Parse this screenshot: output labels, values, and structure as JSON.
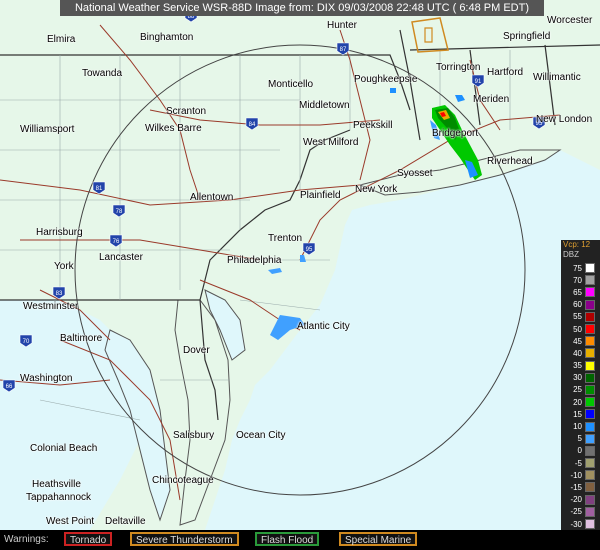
{
  "title": "National Weather Service WSR-88D Image from: DIX 09/03/2008 22:48 UTC ( 6:48 PM EDT)",
  "cities": [
    {
      "name": "Elmira"
    },
    {
      "name": "Binghamton"
    },
    {
      "name": "Hunter"
    },
    {
      "name": "Worcester"
    },
    {
      "name": "Springfield"
    },
    {
      "name": "Towanda"
    },
    {
      "name": "Poughkeepsie"
    },
    {
      "name": "Torrington"
    },
    {
      "name": "Hartford"
    },
    {
      "name": "Willimantic"
    },
    {
      "name": "Monticello"
    },
    {
      "name": "Meriden"
    },
    {
      "name": "Scranton"
    },
    {
      "name": "Wilkes Barre"
    },
    {
      "name": "Middletown"
    },
    {
      "name": "New London"
    },
    {
      "name": "Williamsport"
    },
    {
      "name": "Peekskill"
    },
    {
      "name": "Bridgeport"
    },
    {
      "name": "West Milford"
    },
    {
      "name": "Riverhead"
    },
    {
      "name": "Syosset"
    },
    {
      "name": "New York"
    },
    {
      "name": "Allentown"
    },
    {
      "name": "Plainfield"
    },
    {
      "name": "Trenton"
    },
    {
      "name": "Harrisburg"
    },
    {
      "name": "Philadelphia"
    },
    {
      "name": "Lancaster"
    },
    {
      "name": "York"
    },
    {
      "name": "Westminster"
    },
    {
      "name": "Atlantic City"
    },
    {
      "name": "Baltimore"
    },
    {
      "name": "Dover"
    },
    {
      "name": "Washington"
    },
    {
      "name": "Salisbury"
    },
    {
      "name": "Ocean City"
    },
    {
      "name": "Colonial Beach"
    },
    {
      "name": "Chincoteague"
    },
    {
      "name": "Heathsville"
    },
    {
      "name": "Tappahannock"
    },
    {
      "name": "West Point"
    },
    {
      "name": "Deltaville"
    }
  ],
  "interstates": [
    "88",
    "87",
    "84",
    "81",
    "78",
    "76",
    "83",
    "70",
    "95",
    "66",
    "91",
    "95"
  ],
  "legend": {
    "vcp": "Vcp: 12",
    "unit": "DBZ",
    "rows": [
      {
        "label": "75",
        "color": "#ffffff"
      },
      {
        "label": "70",
        "color": "#a0a0a0"
      },
      {
        "label": "65",
        "color": "#ff00ff"
      },
      {
        "label": "60",
        "color": "#8b008b"
      },
      {
        "label": "55",
        "color": "#b00000"
      },
      {
        "label": "50",
        "color": "#ff0000"
      },
      {
        "label": "45",
        "color": "#ff8c00"
      },
      {
        "label": "40",
        "color": "#e8b000"
      },
      {
        "label": "35",
        "color": "#ffff00"
      },
      {
        "label": "30",
        "color": "#006400"
      },
      {
        "label": "25",
        "color": "#008c00"
      },
      {
        "label": "20",
        "color": "#00c800"
      },
      {
        "label": "15",
        "color": "#0000ff"
      },
      {
        "label": "10",
        "color": "#1e90ff"
      },
      {
        "label": "5",
        "color": "#40a0ff"
      },
      {
        "label": "0",
        "color": "#707070"
      },
      {
        "label": "-5",
        "color": "#a0a070"
      },
      {
        "label": "-10",
        "color": "#a09060"
      },
      {
        "label": "-15",
        "color": "#806040"
      },
      {
        "label": "-20",
        "color": "#804080"
      },
      {
        "label": "-25",
        "color": "#a060a0"
      },
      {
        "label": "-30",
        "color": "#e0c0e0"
      },
      {
        "label": "ND",
        "color": "#808080"
      }
    ]
  },
  "warnings": {
    "label": "Warnings:",
    "items": [
      {
        "name": "Tornado",
        "color": "#cc2222"
      },
      {
        "name": "Severe Thunderstorm",
        "color": "#d08a20"
      },
      {
        "name": "Flash Flood",
        "color": "#2a9a3a"
      },
      {
        "name": "Special Marine",
        "color": "#d08a20"
      }
    ]
  }
}
